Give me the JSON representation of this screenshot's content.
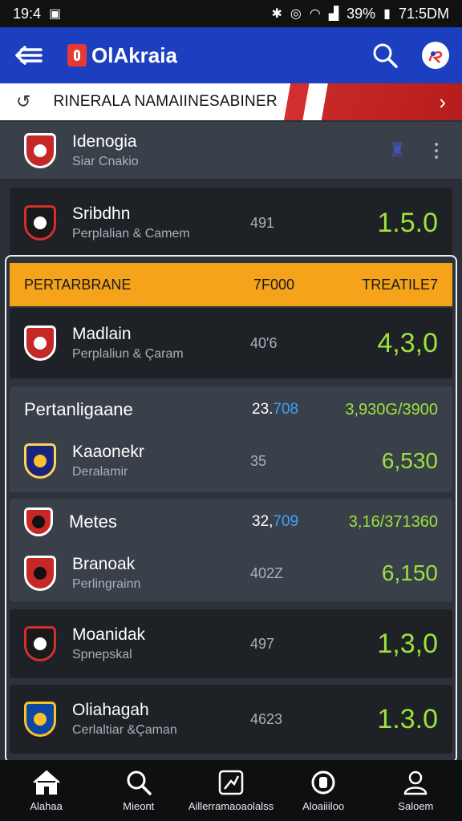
{
  "status_bar": {
    "time_left": "19:4",
    "battery": "39%",
    "clock": "71:5DM"
  },
  "app_bar": {
    "title": "OlAkraia"
  },
  "banner": {
    "title": "RINERALA NAMAIINESABINER"
  },
  "league": {
    "name": "Idenogia",
    "subtitle": "Siar Cnakio"
  },
  "match_top": {
    "name": "Sribdhn",
    "subtitle": "Perplalian & Camem",
    "count": "491",
    "score": "1.5.0"
  },
  "panel_header": {
    "left": "PERTARBRANE",
    "mid": "7F000",
    "right": "TREATILE7"
  },
  "matches": [
    {
      "name": "Madlain",
      "subtitle": "Perplaliun & Çaram",
      "count": "40'6",
      "score": "4,3,0"
    }
  ],
  "group1": {
    "title": "Pertanligaane",
    "count_main": "23.",
    "count_hi": "708",
    "odds": "3,930G/3900",
    "row": {
      "name": "Kaaonekr",
      "subtitle": "Deralamir",
      "count": "35",
      "score": "6,530"
    }
  },
  "group2": {
    "title": "Metes",
    "count_main": "32,",
    "count_hi": "709",
    "odds": "3,16/371360",
    "row": {
      "name": "Branoak",
      "subtitle": "Perlingrainn",
      "count": "402Z",
      "score": "6,150"
    }
  },
  "match_a": {
    "name": "Moanidak",
    "subtitle": "Spnepskal",
    "count": "497",
    "score": "1,3,0"
  },
  "match_b": {
    "name": "Oliahagah",
    "subtitle": "Cerlaltiar &Çaman",
    "count": "4623",
    "score": "1.3.0"
  },
  "bottom_nav": [
    {
      "label": "Alahaa",
      "icon": "home-icon"
    },
    {
      "label": "Mieont",
      "icon": "search-icon"
    },
    {
      "label": "Aillerramaoaolalss",
      "icon": "chart-icon"
    },
    {
      "label": "Aloaiiiloo",
      "icon": "badge-icon"
    },
    {
      "label": "Saloem",
      "icon": "profile-icon"
    }
  ],
  "colors": {
    "accent_blue": "#1c3fbf",
    "header_orange": "#f5a31a",
    "score_green": "#9be23c"
  }
}
